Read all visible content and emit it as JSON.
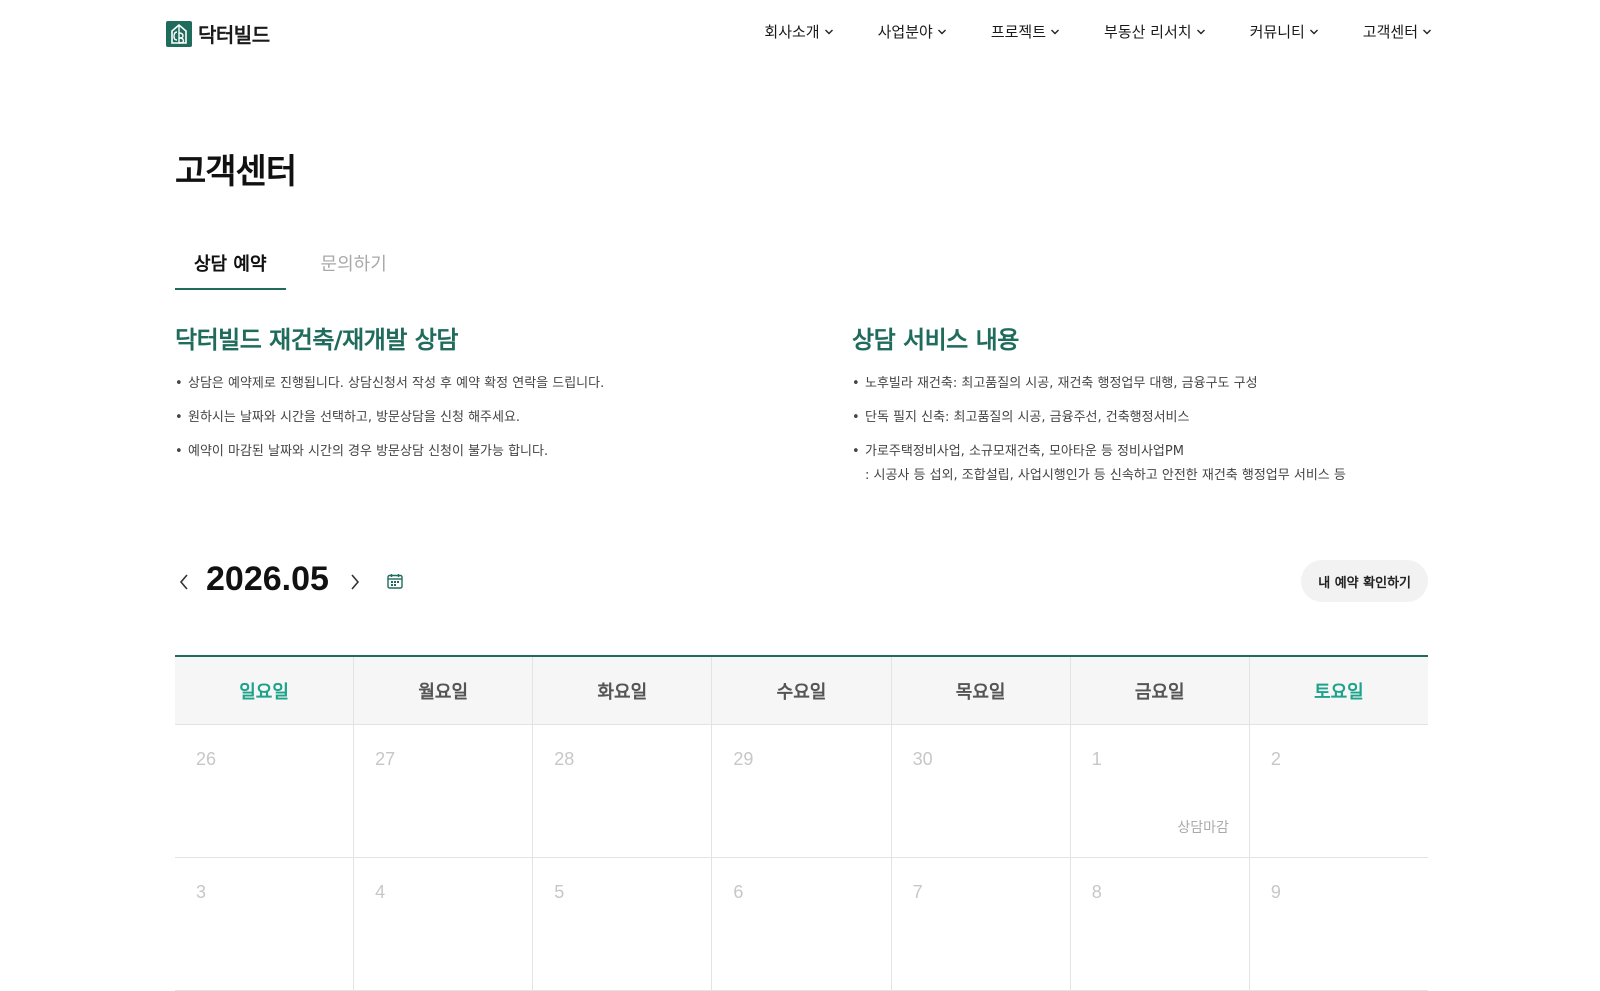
{
  "logo": {
    "text": "닥터빌드"
  },
  "nav": [
    {
      "label": "회사소개"
    },
    {
      "label": "사업분야"
    },
    {
      "label": "프로젝트"
    },
    {
      "label": "부동산 리서치"
    },
    {
      "label": "커뮤니티"
    },
    {
      "label": "고객센터"
    }
  ],
  "page_title": "고객센터",
  "tabs": [
    {
      "label": "상담 예약",
      "active": true
    },
    {
      "label": "문의하기",
      "active": false
    }
  ],
  "left_section": {
    "title": "닥터빌드 재건축/재개발 상담",
    "bullets": [
      "상담은 예약제로 진행됩니다. 상담신청서 작성 후 예약 확정 연락을 드립니다.",
      "원하시는 날짜와 시간을 선택하고, 방문상담을 신청 해주세요.",
      "예약이 마감된 날짜와 시간의 경우 방문상담 신청이 불가능 합니다."
    ]
  },
  "right_section": {
    "title": "상담 서비스 내용",
    "bullets": [
      {
        "text": "노후빌라 재건축: 최고품질의 시공, 재건축 행정업무 대행, 금융구도 구성",
        "sub": ""
      },
      {
        "text": "단독 필지 신축: 최고품질의 시공, 금융주선, 건축행정서비스",
        "sub": ""
      },
      {
        "text": "가로주택정비사업, 소규모재건축, 모아타운 등 정비사업PM",
        "sub": ": 시공사 등 섭외, 조합설립, 사업시행인가 등 신속하고 안전한 재건축 행정업무 서비스 등"
      }
    ]
  },
  "calendar": {
    "month": "2026.05",
    "my_booking_label": "내 예약 확인하기",
    "days_of_week": [
      "일요일",
      "월요일",
      "화요일",
      "수요일",
      "목요일",
      "금요일",
      "토요일"
    ],
    "weeks": [
      [
        {
          "num": "26",
          "status": ""
        },
        {
          "num": "27",
          "status": ""
        },
        {
          "num": "28",
          "status": ""
        },
        {
          "num": "29",
          "status": ""
        },
        {
          "num": "30",
          "status": ""
        },
        {
          "num": "1",
          "status": "상담마감"
        },
        {
          "num": "2",
          "status": ""
        }
      ],
      [
        {
          "num": "3",
          "status": ""
        },
        {
          "num": "4",
          "status": ""
        },
        {
          "num": "5",
          "status": ""
        },
        {
          "num": "6",
          "status": ""
        },
        {
          "num": "7",
          "status": ""
        },
        {
          "num": "8",
          "status": ""
        },
        {
          "num": "9",
          "status": ""
        }
      ]
    ]
  },
  "colors": {
    "accent": "#1f6b5c",
    "weekend": "#1ea38b"
  },
  "icons": {
    "logo": "building-logo-icon",
    "nav_chevron": "chevron-down-icon",
    "prev": "chevron-left-icon",
    "next": "chevron-right-icon",
    "calendar": "calendar-icon"
  }
}
